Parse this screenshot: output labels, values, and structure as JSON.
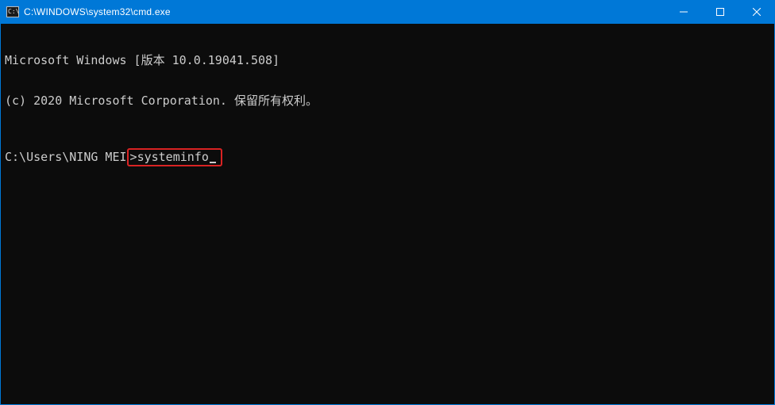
{
  "window": {
    "title": "C:\\WINDOWS\\system32\\cmd.exe"
  },
  "terminal": {
    "line1": "Microsoft Windows [版本 10.0.19041.508]",
    "line2": "(c) 2020 Microsoft Corporation. 保留所有权利。",
    "prompt_prefix": "C:\\Users\\NING MEI",
    "prompt_char": ">",
    "command": "systeminfo"
  },
  "colors": {
    "titlebar": "#0078d7",
    "highlight": "#d92323",
    "bg": "#0c0c0c",
    "fg": "#cccccc"
  }
}
